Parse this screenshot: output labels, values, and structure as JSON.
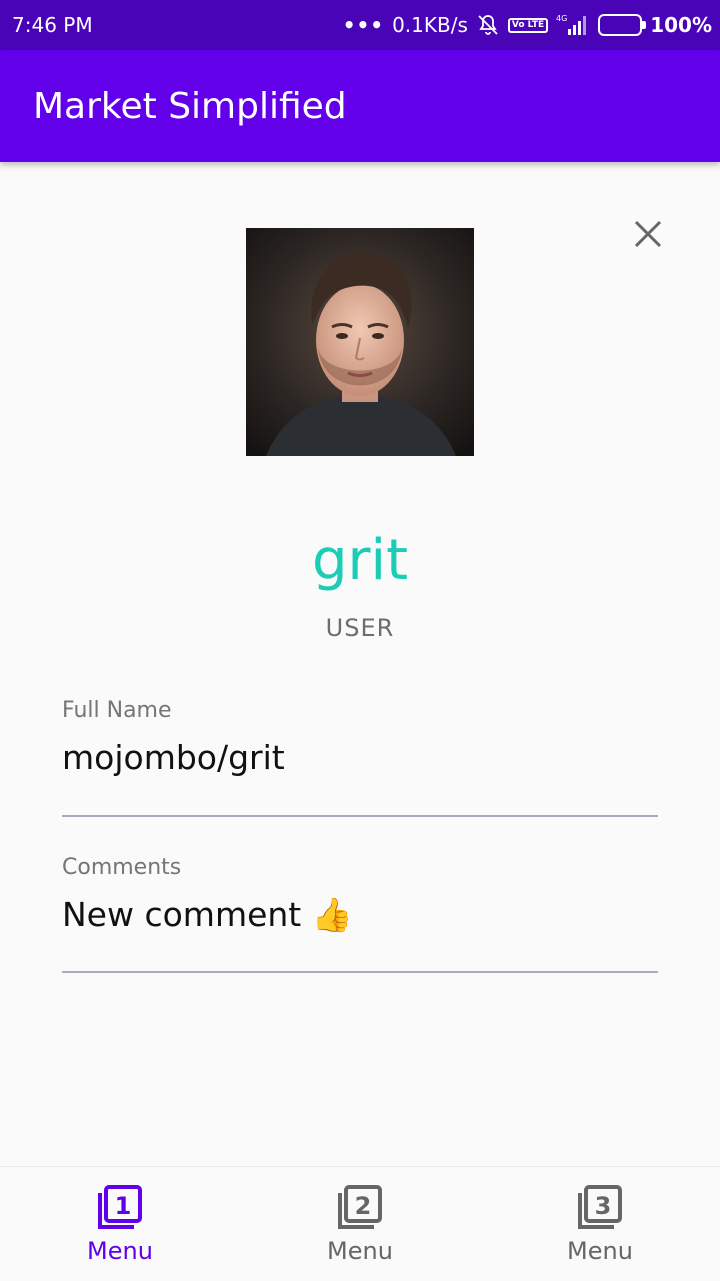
{
  "status_bar": {
    "time": "7:46 PM",
    "network_speed": "0.1KB/s",
    "network_type": "4G",
    "volte_label": "Vo LTE",
    "battery": "100%",
    "icons": [
      "more-dots-icon",
      "mute-icon",
      "volte-icon",
      "signal-icon",
      "battery-charging-icon"
    ]
  },
  "app_bar": {
    "title": "Market Simplified"
  },
  "detail": {
    "close_icon": "close-icon",
    "avatar_alt": "avatar",
    "name": "grit",
    "type": "USER",
    "fields": [
      {
        "label": "Full Name",
        "value": "mojombo/grit"
      },
      {
        "label": "Comments",
        "value": "New comment 👍"
      }
    ]
  },
  "bottom_nav": {
    "items": [
      {
        "label": "Menu",
        "icon": "filter-1-icon",
        "number": "1",
        "active": true
      },
      {
        "label": "Menu",
        "icon": "filter-2-icon",
        "number": "2",
        "active": false
      },
      {
        "label": "Menu",
        "icon": "filter-3-icon",
        "number": "3",
        "active": false
      }
    ]
  },
  "colors": {
    "status_bar": "#4a04b8",
    "app_bar": "#6200ea",
    "accent_teal": "#1bcdb5",
    "active_nav": "#6200ea",
    "inactive_nav": "#666666"
  }
}
